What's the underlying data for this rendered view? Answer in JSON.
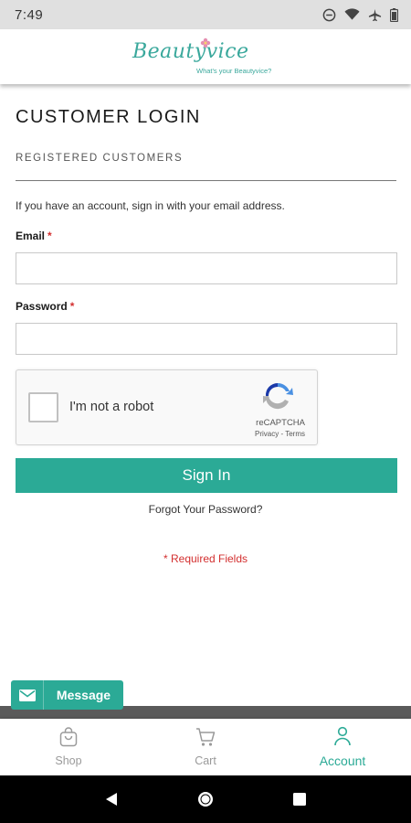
{
  "status_bar": {
    "time": "7:49",
    "icons": [
      "do-not-disturb-icon",
      "wifi-icon",
      "airplane-icon",
      "battery-icon"
    ]
  },
  "header": {
    "logo_text": "Beautyvice",
    "logo_tagline": "What's your Beautyvice?"
  },
  "page": {
    "title": "CUSTOMER LOGIN",
    "section_label": "REGISTERED CUSTOMERS",
    "intro": "If you have an account, sign in with your email address."
  },
  "form": {
    "email_label": "Email",
    "email_value": "",
    "password_label": "Password",
    "password_value": "",
    "required_marker": "*",
    "captcha_label": "I'm not a robot",
    "captcha_brand": "reCAPTCHA",
    "captcha_links": "Privacy - Terms",
    "signin_label": "Sign In",
    "forgot_label": "Forgot Your Password?",
    "required_note": "* Required Fields"
  },
  "message_button": {
    "label": "Message"
  },
  "bottom_nav": {
    "items": [
      {
        "label": "Shop",
        "icon": "bag-icon",
        "active": false
      },
      {
        "label": "Cart",
        "icon": "cart-icon",
        "active": false
      },
      {
        "label": "Account",
        "icon": "person-icon",
        "active": true
      }
    ]
  },
  "colors": {
    "accent": "#2baa96",
    "required": "#d32f2f",
    "logo": "#3aa89c"
  }
}
